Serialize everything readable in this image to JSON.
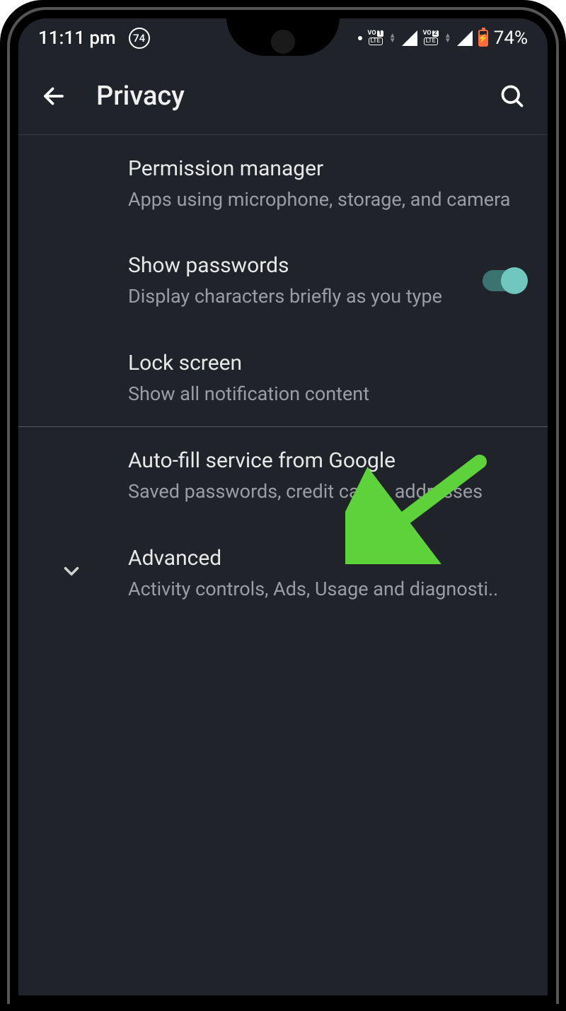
{
  "status": {
    "time": "11:11 pm",
    "circle_number": "74",
    "battery_percent": "74%",
    "volte1_num": "1",
    "volte2_num": "2",
    "volte_vo": "VO",
    "volte_lte": "LTE"
  },
  "appbar": {
    "title": "Privacy"
  },
  "settings": {
    "permission_manager": {
      "title": "Permission manager",
      "subtitle": "Apps using microphone, storage, and camera"
    },
    "show_passwords": {
      "title": "Show passwords",
      "subtitle": "Display characters briefly as you type",
      "toggle_on": true
    },
    "lock_screen": {
      "title": "Lock screen",
      "subtitle": "Show all notification content"
    },
    "autofill": {
      "title": "Auto-fill service from Google",
      "subtitle": "Saved passwords, credit cards, addresses"
    },
    "advanced": {
      "title": "Advanced",
      "subtitle": "Activity controls, Ads, Usage and diagnosti.."
    }
  }
}
